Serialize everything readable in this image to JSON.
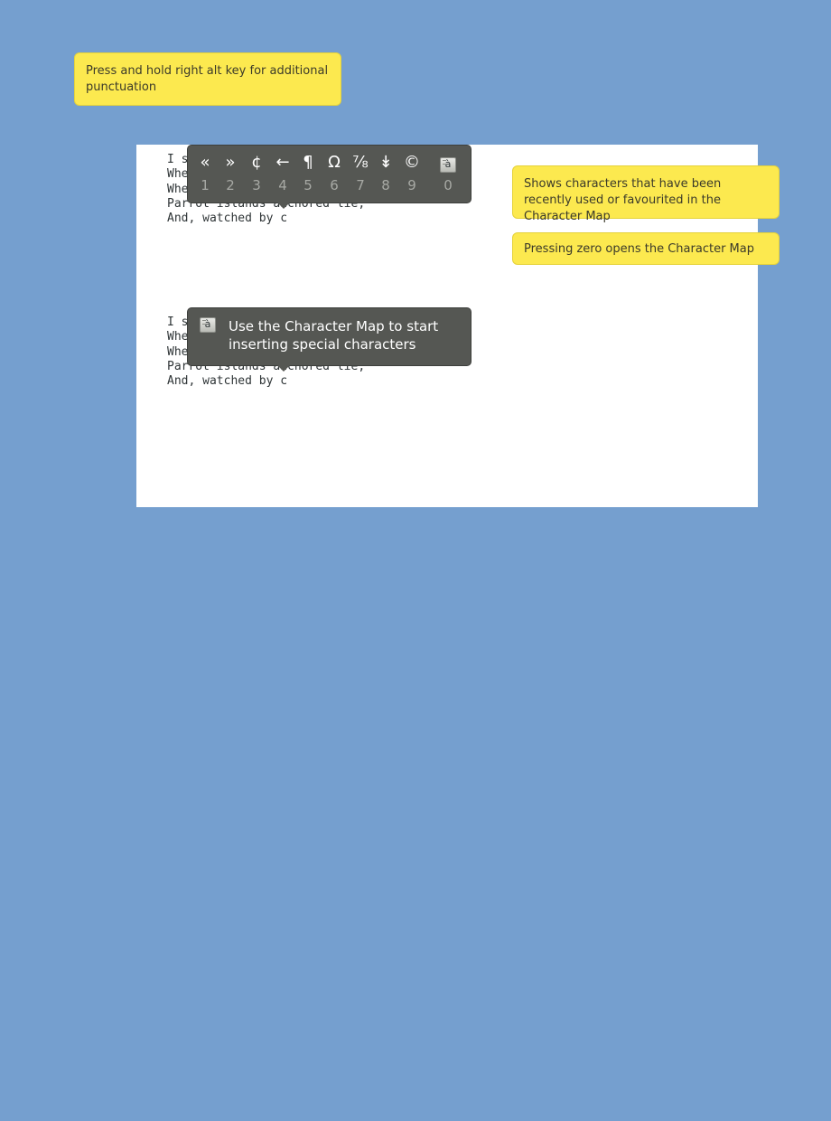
{
  "notes": {
    "alt_key": "Press and hold right alt key for additional punctuation",
    "recent": "Shows characters that have been recently used or favourited in the Character Map",
    "zero": "Pressing zero opens the Character Map"
  },
  "document": {
    "block1": "I s\nWhe\nWhe\nParrot islands anchored lie,\nAnd, watched by c",
    "block2": "I s\nWhe\nWhe\nParrot islands anchored lie,\nAnd, watched by c"
  },
  "char_popup": {
    "chars": [
      "«",
      "»",
      "¢",
      "←",
      "¶",
      "Ω",
      "⅞",
      "↡",
      "©"
    ],
    "numbers": [
      "1",
      "2",
      "3",
      "4",
      "5",
      "6",
      "7",
      "8",
      "9"
    ],
    "charmap_glyph": "à",
    "charmap_number": "0"
  },
  "hint_popup": {
    "text": "Use the Character Map to start inserting special characters",
    "icon": "character-map-icon"
  },
  "colors": {
    "background": "#759fcf",
    "note": "#fce94f",
    "popup": "#555753"
  }
}
